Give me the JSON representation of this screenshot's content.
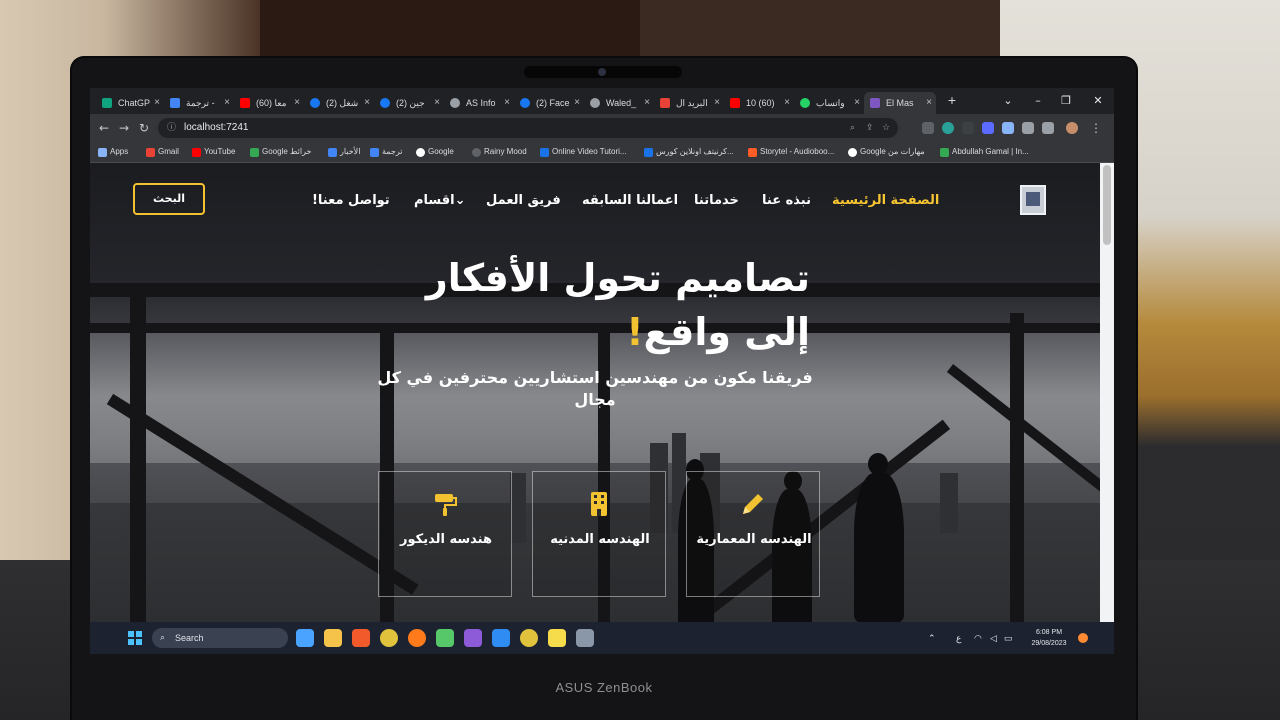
{
  "browser": {
    "tabs": [
      {
        "label": "ChatGP",
        "color": "#10a37f"
      },
      {
        "label": "ترجمة -",
        "color": "#4285f4"
      },
      {
        "label": "(60) معا",
        "color": "#ff0000"
      },
      {
        "label": "(2) شغل",
        "color": "#1877f2"
      },
      {
        "label": "(2) جين",
        "color": "#1877f2"
      },
      {
        "label": "AS Info",
        "color": "#9aa0a6"
      },
      {
        "label": "(2) Face",
        "color": "#1877f2"
      },
      {
        "label": "Waled_",
        "color": "#9aa0a6"
      },
      {
        "label": "البريد ال",
        "color": "#ea4335"
      },
      {
        "label": "10 (60)",
        "color": "#ff0000"
      },
      {
        "label": "واتساب",
        "color": "#25d366"
      },
      {
        "label": "El Mas",
        "color": "#7e57c2",
        "active": true
      }
    ],
    "new_tab": "+",
    "url": "localhost:7241",
    "bookmarks": [
      {
        "label": "Apps",
        "color": "#8ab4f8"
      },
      {
        "label": "Gmail",
        "color": "#ea4335"
      },
      {
        "label": "YouTube",
        "color": "#ff0000"
      },
      {
        "label": "Google خرائط",
        "color": "#34a853"
      },
      {
        "label": "الأخبار",
        "color": "#4285f4"
      },
      {
        "label": "ترجمة",
        "color": "#4285f4"
      },
      {
        "label": "Google",
        "color": "#ffffff"
      },
      {
        "label": "Rainy Mood",
        "color": "#5f6368"
      },
      {
        "label": "Online Video Tutori...",
        "color": "#1a73e8"
      },
      {
        "label": "كرنيتف اونلاين كورس...",
        "color": "#1a73e8"
      },
      {
        "label": "Storytel - Audioboo...",
        "color": "#ff5c28"
      },
      {
        "label": "Google مهارات من",
        "color": "#ffffff"
      },
      {
        "label": "Abdullah Gamal | In...",
        "color": "#34a853"
      }
    ]
  },
  "site": {
    "nav": {
      "home": "الصفحة الرئيسية",
      "about": "نبذه عنا",
      "services": "خدماتنا",
      "previous_work": "اعمالنا السابقه",
      "team": "فريق العمل",
      "departments": "اقسام",
      "contact": "تواصل معنا!",
      "search": "البحث"
    },
    "hero": {
      "title_line1": "تصاميم تحول الأفكار",
      "title_line2": "إلى واقع",
      "title_accent": "!",
      "subtitle": "فريقنا مكون من مهندسين استشاريين محترفين في كل مجال"
    },
    "cards": [
      {
        "label": "الهندسه المعمارية",
        "icon": "pencil-icon"
      },
      {
        "label": "الهندسه المدنيه",
        "icon": "building-icon"
      },
      {
        "label": "هندسه الديكور",
        "icon": "paint-roller-icon"
      }
    ],
    "accent_color": "#f2c230"
  },
  "taskbar": {
    "search_label": "Search",
    "language": "ع",
    "time": "6:08 PM",
    "date": "29/08/2023"
  },
  "laptop": {
    "brand": "ASUS ZenBook"
  }
}
